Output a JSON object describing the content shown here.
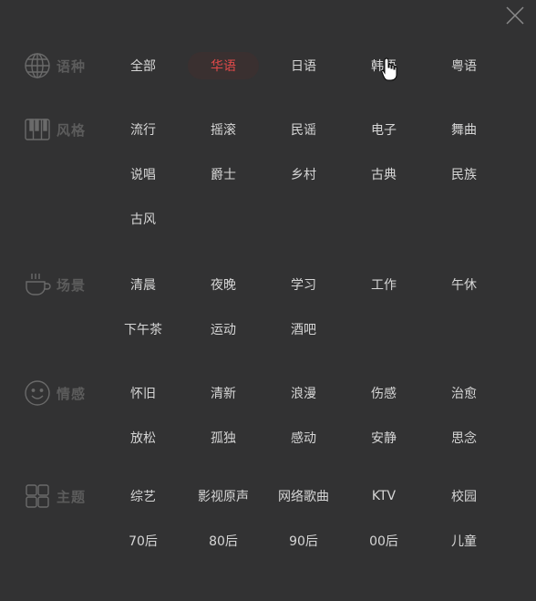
{
  "close_icon": "close-icon",
  "categories": [
    {
      "label": "语种",
      "icon": "globe-icon",
      "tags": [
        "全部",
        "华语",
        "日语",
        "韩语",
        "粤语"
      ],
      "active_index": 1
    },
    {
      "label": "风格",
      "icon": "piano-icon",
      "tags": [
        "流行",
        "摇滚",
        "民谣",
        "电子",
        "舞曲",
        "说唱",
        "爵士",
        "乡村",
        "古典",
        "民族",
        "古风"
      ]
    },
    {
      "label": "场景",
      "icon": "coffee-cup-icon",
      "tags": [
        "清晨",
        "夜晚",
        "学习",
        "工作",
        "午休",
        "下午茶",
        "运动",
        "酒吧"
      ]
    },
    {
      "label": "情感",
      "icon": "smiley-icon",
      "tags": [
        "怀旧",
        "清新",
        "浪漫",
        "伤感",
        "治愈",
        "放松",
        "孤独",
        "感动",
        "安静",
        "思念"
      ]
    },
    {
      "label": "主题",
      "icon": "grid-icon",
      "tags": [
        "综艺",
        "影视原声",
        "网络歌曲",
        "KTV",
        "校园",
        "70后",
        "80后",
        "90后",
        "00后",
        "儿童"
      ]
    }
  ],
  "colors": {
    "background": "#323233",
    "active": "#e04a4a",
    "label_muted": "#5c5c5c",
    "text": "#d6d6d6"
  }
}
